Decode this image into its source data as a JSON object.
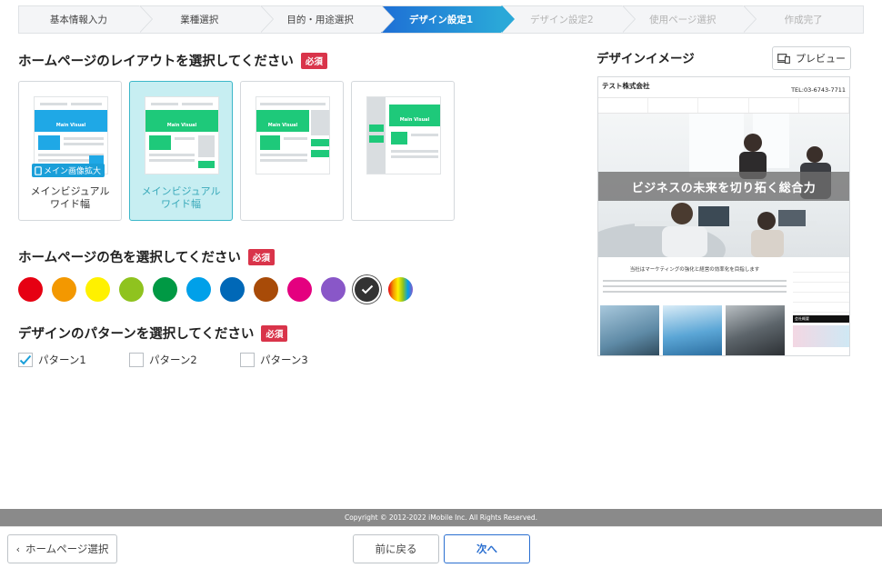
{
  "steps": [
    {
      "label": "基本情報入力",
      "state": "done"
    },
    {
      "label": "業種選択",
      "state": "done"
    },
    {
      "label": "目的・用途選択",
      "state": "done"
    },
    {
      "label": "デザイン設定1",
      "state": "active"
    },
    {
      "label": "デザイン設定2",
      "state": "todo"
    },
    {
      "label": "使用ページ選択",
      "state": "todo"
    },
    {
      "label": "作成完了",
      "state": "todo"
    }
  ],
  "required_label": "必須",
  "layout_section": {
    "title": "ホームページのレイアウトを選択してください",
    "options": [
      {
        "caption_line1": "メインビジュアル",
        "caption_line2": "ワイド幅",
        "selected": false,
        "badge": "メイン画像拡大",
        "visual_label": "Main Visual"
      },
      {
        "caption_line1": "メインビジュアル",
        "caption_line2": "ワイド幅",
        "selected": true,
        "visual_label": "Main Visual"
      },
      {
        "caption_line1": "",
        "caption_line2": "",
        "selected": false,
        "visual_label": "Main Visual"
      },
      {
        "caption_line1": "",
        "caption_line2": "",
        "selected": false,
        "visual_label": "Main Visual"
      }
    ]
  },
  "color_section": {
    "title": "ホームページの色を選択してください",
    "colors": [
      "#e60012",
      "#f39800",
      "#fff100",
      "#8fc31f",
      "#009944",
      "#00a0e9",
      "#0068b7",
      "#a84b08",
      "#e4007f",
      "#8957c8",
      "#333333",
      "gradient"
    ],
    "selected_index": 10
  },
  "pattern_section": {
    "title": "デザインのパターンを選択してください",
    "patterns": [
      {
        "label": "パターン1",
        "checked": true
      },
      {
        "label": "パターン2",
        "checked": false
      },
      {
        "label": "パターン3",
        "checked": false
      }
    ]
  },
  "design_preview": {
    "title": "デザインイメージ",
    "preview_button": "プレビュー",
    "company": "テスト株式会社",
    "tel": "TEL:03-6743-7711",
    "hero_text": "ビジネスの未来を切り拓く総合力",
    "lead_text": "当社はマーケティングの強化と経営の効率化を目指します",
    "side_box": "会社概要"
  },
  "footer": {
    "copyright": "Copyright © 2012-2022 iMobile Inc. All Rights Reserved.",
    "back_home": "ホームページ選択",
    "prev": "前に戻る",
    "next": "次へ"
  }
}
